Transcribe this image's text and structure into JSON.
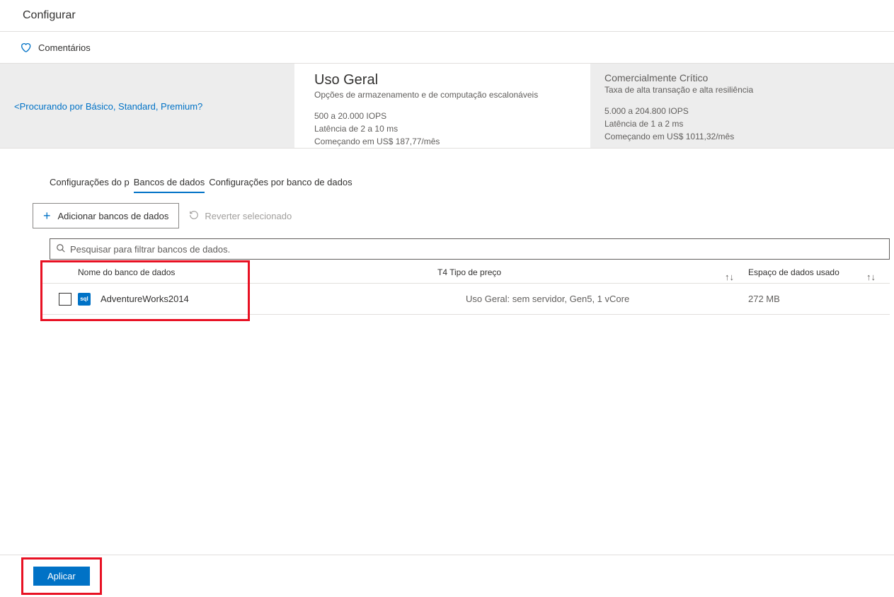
{
  "header": {
    "title": "Configurar"
  },
  "comments": {
    "label": "Comentários"
  },
  "tiers": {
    "search_link": "<Procurando por Básico, Standard, Premium?",
    "general": {
      "title": "Uso Geral",
      "subtitle": "Opções de armazenamento e de computação escalonáveis",
      "iops": "500 a 20.000 IOPS",
      "latency": "Latência de 2 a 10 ms",
      "price": "Começando em US$ 187,77/",
      "per": "mês"
    },
    "critical": {
      "title": "Comercialmente Crítico",
      "subtitle": "Taxa de alta transação e alta resiliência",
      "iops": "5.000 a 204.800 IOPS",
      "latency": "Latência de 1 a 2 ms",
      "price": "Começando em US$ 1011,32/",
      "per": "mês"
    }
  },
  "tabs": {
    "pool": "Configurações do p",
    "databases": "Bancos de dados",
    "perdb": "Configurações por banco de dados"
  },
  "toolbar": {
    "add": "Adicionar bancos de dados",
    "revert": "Reverter selecionado"
  },
  "search": {
    "placeholder": "Pesquisar para filtrar bancos de dados."
  },
  "table": {
    "headers": {
      "name": "Nome do banco de dados",
      "price": "T4 Tipo de preço",
      "space": "Espaço de dados usado"
    },
    "rows": [
      {
        "name": "AdventureWorks2014",
        "price": "Uso Geral: sem servidor, Gen5, 1 vCore",
        "space": "272 MB"
      }
    ]
  },
  "footer": {
    "apply": "Aplicar"
  }
}
